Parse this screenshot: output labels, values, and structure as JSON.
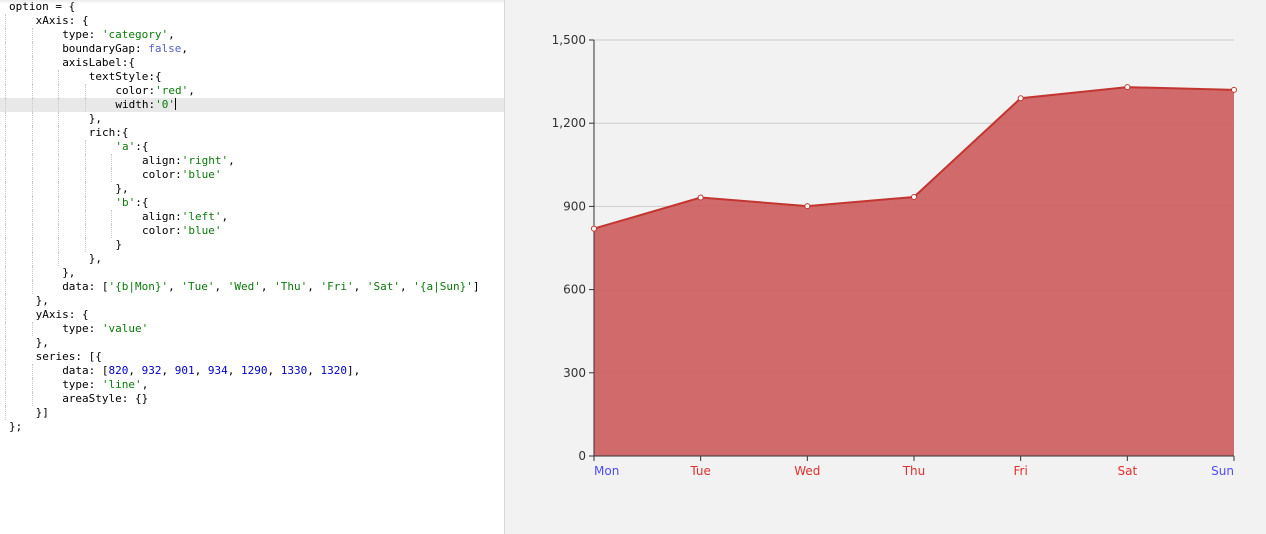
{
  "editor": {
    "lines": [
      {
        "indent": 0,
        "guides": [],
        "fold": "",
        "tokens": [
          [
            "k",
            "option = {"
          ]
        ]
      },
      {
        "indent": 1,
        "guides": [
          0
        ],
        "fold": "",
        "tokens": [
          [
            "k",
            "xAxis: {"
          ]
        ]
      },
      {
        "indent": 2,
        "guides": [
          0,
          1
        ],
        "fold": "",
        "tokens": [
          [
            "k",
            "type: "
          ],
          [
            "s",
            "'category'"
          ],
          [
            "p",
            ","
          ]
        ]
      },
      {
        "indent": 2,
        "guides": [
          0,
          1
        ],
        "fold": "",
        "tokens": [
          [
            "k",
            "boundaryGap: "
          ],
          [
            "b",
            "false"
          ],
          [
            "p",
            ","
          ]
        ]
      },
      {
        "indent": 2,
        "guides": [
          0,
          1
        ],
        "fold": "",
        "tokens": [
          [
            "k",
            "axisLabel:{"
          ]
        ]
      },
      {
        "indent": 3,
        "guides": [
          0,
          1,
          2
        ],
        "fold": "",
        "tokens": [
          [
            "k",
            "textStyle:{"
          ]
        ]
      },
      {
        "indent": 4,
        "guides": [
          0,
          1,
          2,
          3
        ],
        "fold": "",
        "tokens": [
          [
            "k",
            "color:"
          ],
          [
            "s",
            "'red'"
          ],
          [
            "p",
            ","
          ]
        ]
      },
      {
        "indent": 4,
        "guides": [
          0,
          1,
          2,
          3
        ],
        "fold": "",
        "active": true,
        "caret": true,
        "tokens": [
          [
            "k",
            "width:"
          ],
          [
            "s",
            "'0'"
          ]
        ]
      },
      {
        "indent": 3,
        "guides": [
          0,
          1,
          2
        ],
        "fold": "",
        "tokens": [
          [
            "p",
            "},"
          ]
        ]
      },
      {
        "indent": 3,
        "guides": [
          0,
          1,
          2
        ],
        "fold": "",
        "tokens": [
          [
            "k",
            "rich:{"
          ]
        ]
      },
      {
        "indent": 4,
        "guides": [
          0,
          1,
          2,
          3
        ],
        "fold": "",
        "tokens": [
          [
            "s",
            "'a'"
          ],
          [
            "p",
            ":{"
          ]
        ]
      },
      {
        "indent": 5,
        "guides": [
          0,
          1,
          2,
          3,
          4
        ],
        "fold": "",
        "tokens": [
          [
            "k",
            "align:"
          ],
          [
            "s",
            "'right'"
          ],
          [
            "p",
            ","
          ]
        ]
      },
      {
        "indent": 5,
        "guides": [
          0,
          1,
          2,
          3,
          4
        ],
        "fold": "",
        "tokens": [
          [
            "k",
            "color:"
          ],
          [
            "s",
            "'blue'"
          ]
        ]
      },
      {
        "indent": 4,
        "guides": [
          0,
          1,
          2,
          3
        ],
        "fold": "",
        "tokens": [
          [
            "p",
            "},"
          ]
        ]
      },
      {
        "indent": 4,
        "guides": [
          0,
          1,
          2,
          3
        ],
        "fold": "",
        "tokens": [
          [
            "s",
            "'b'"
          ],
          [
            "p",
            ":{"
          ]
        ]
      },
      {
        "indent": 5,
        "guides": [
          0,
          1,
          2,
          3,
          4
        ],
        "fold": "",
        "tokens": [
          [
            "k",
            "align:"
          ],
          [
            "s",
            "'left'"
          ],
          [
            "p",
            ","
          ]
        ]
      },
      {
        "indent": 5,
        "guides": [
          0,
          1,
          2,
          3,
          4
        ],
        "fold": "",
        "tokens": [
          [
            "k",
            "color:"
          ],
          [
            "s",
            "'blue'"
          ]
        ]
      },
      {
        "indent": 4,
        "guides": [
          0,
          1,
          2,
          3
        ],
        "fold": "",
        "tokens": [
          [
            "p",
            "}"
          ]
        ]
      },
      {
        "indent": 3,
        "guides": [
          0,
          1,
          2
        ],
        "fold": "",
        "tokens": [
          [
            "p",
            "},"
          ]
        ]
      },
      {
        "indent": 2,
        "guides": [
          0,
          1
        ],
        "fold": "",
        "tokens": [
          [
            "p",
            "},"
          ]
        ]
      },
      {
        "indent": 2,
        "guides": [
          0,
          1
        ],
        "fold": "",
        "tokens": [
          [
            "k",
            "data: ["
          ],
          [
            "s",
            "'{b|Mon}'"
          ],
          [
            "p",
            ", "
          ],
          [
            "s",
            "'Tue'"
          ],
          [
            "p",
            ", "
          ],
          [
            "s",
            "'Wed'"
          ],
          [
            "p",
            ", "
          ],
          [
            "s",
            "'Thu'"
          ],
          [
            "p",
            ", "
          ],
          [
            "s",
            "'Fri'"
          ],
          [
            "p",
            ", "
          ],
          [
            "s",
            "'Sat'"
          ],
          [
            "p",
            ", "
          ],
          [
            "s",
            "'{a|Sun}'"
          ],
          [
            "p",
            "]"
          ]
        ]
      },
      {
        "indent": 1,
        "guides": [
          0
        ],
        "fold": "",
        "tokens": [
          [
            "p",
            "},"
          ]
        ]
      },
      {
        "indent": 1,
        "guides": [
          0
        ],
        "fold": "",
        "tokens": [
          [
            "k",
            "yAxis: {"
          ]
        ]
      },
      {
        "indent": 2,
        "guides": [
          0,
          1
        ],
        "fold": "",
        "tokens": [
          [
            "k",
            "type: "
          ],
          [
            "s",
            "'value'"
          ]
        ]
      },
      {
        "indent": 1,
        "guides": [
          0
        ],
        "fold": "",
        "tokens": [
          [
            "p",
            "},"
          ]
        ]
      },
      {
        "indent": 1,
        "guides": [
          0
        ],
        "fold": "",
        "tokens": [
          [
            "k",
            "series: [{"
          ]
        ]
      },
      {
        "indent": 2,
        "guides": [
          0,
          1
        ],
        "fold": "",
        "tokens": [
          [
            "k",
            "data: ["
          ],
          [
            "n",
            "820"
          ],
          [
            "p",
            ", "
          ],
          [
            "n",
            "932"
          ],
          [
            "p",
            ", "
          ],
          [
            "n",
            "901"
          ],
          [
            "p",
            ", "
          ],
          [
            "n",
            "934"
          ],
          [
            "p",
            ", "
          ],
          [
            "n",
            "1290"
          ],
          [
            "p",
            ", "
          ],
          [
            "n",
            "1330"
          ],
          [
            "p",
            ", "
          ],
          [
            "n",
            "1320"
          ],
          [
            "p",
            "],"
          ]
        ]
      },
      {
        "indent": 2,
        "guides": [
          0,
          1
        ],
        "fold": "",
        "tokens": [
          [
            "k",
            "type: "
          ],
          [
            "s",
            "'line'"
          ],
          [
            "p",
            ","
          ]
        ]
      },
      {
        "indent": 2,
        "guides": [
          0,
          1
        ],
        "fold": "",
        "tokens": [
          [
            "k",
            "areaStyle: {}"
          ]
        ]
      },
      {
        "indent": 1,
        "guides": [
          0
        ],
        "fold": "",
        "tokens": [
          [
            "p",
            "}]"
          ]
        ]
      },
      {
        "indent": 0,
        "guides": [],
        "fold": "",
        "tokens": [
          [
            "p",
            "};"
          ]
        ]
      }
    ]
  },
  "chart_data": {
    "type": "area",
    "categories": [
      "Mon",
      "Tue",
      "Wed",
      "Thu",
      "Fri",
      "Sat",
      "Sun"
    ],
    "category_colors": [
      "#4d4dff",
      "#e03030",
      "#e03030",
      "#e03030",
      "#e03030",
      "#e03030",
      "#4d4dff"
    ],
    "values": [
      820,
      932,
      901,
      934,
      1290,
      1330,
      1320
    ],
    "y_ticks": [
      0,
      300,
      600,
      900,
      1200,
      1500
    ],
    "y_tick_labels": [
      "0",
      "300",
      "600",
      "900",
      "1,200",
      "1,500"
    ],
    "ylim": [
      0,
      1500
    ],
    "grid": true,
    "line_color": "#c23531",
    "area_color": "#cd5c5c",
    "title": "",
    "xlabel": "",
    "ylabel": ""
  }
}
